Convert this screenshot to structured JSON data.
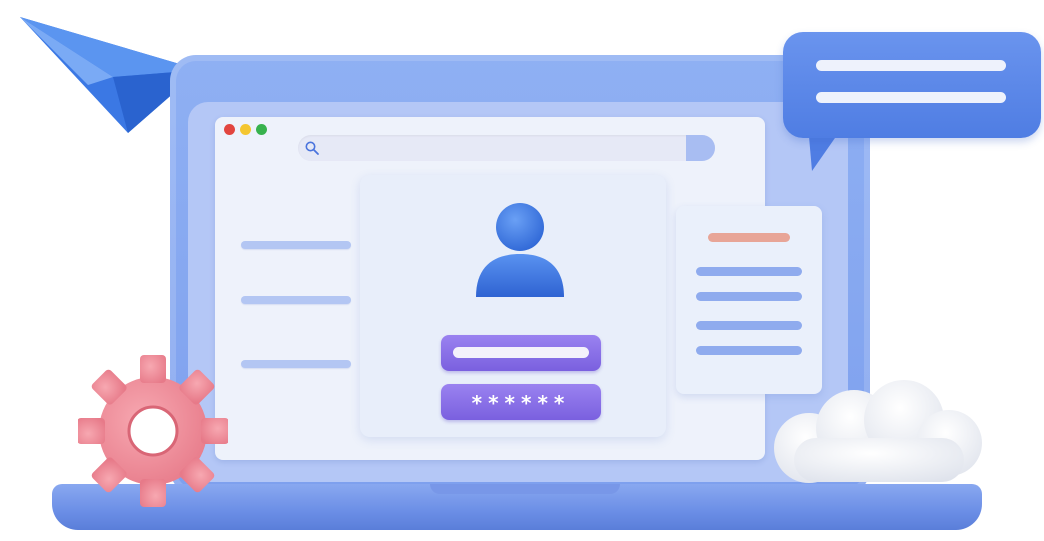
{
  "scene": {
    "icons": {
      "paper_plane": "paper-plane-icon",
      "chat": "chat-bubble-icon",
      "gear": "gear-icon",
      "cloud": "cloud-icon",
      "user": "user-avatar-icon",
      "search": "search-icon"
    },
    "colors": {
      "laptop": "#7ea0ee",
      "accent_purple": "#8a70e8",
      "chat_blue": "#5b88e8",
      "gear_pink": "#ee8e9a",
      "avatar_blue": "#3f7ae0",
      "doc_heading": "#e8a597"
    }
  },
  "login_form": {
    "password_mask": "******"
  }
}
